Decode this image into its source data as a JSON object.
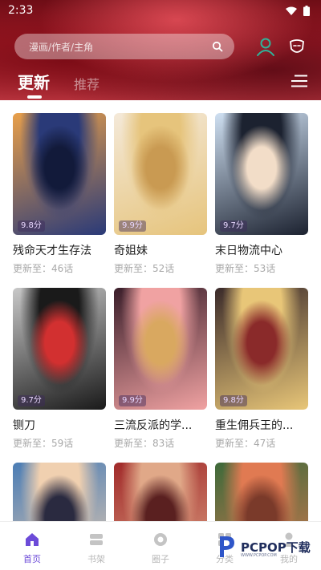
{
  "status": {
    "time": "2:33"
  },
  "search": {
    "placeholder": "漫画/作者/主角"
  },
  "tabs": {
    "active": "更新",
    "inactive": "推荐"
  },
  "comics": [
    {
      "title": "残命天才生存法",
      "update": "更新至：46话",
      "rating": "9.8分",
      "palette": [
        "#e9a04a",
        "#2a3a78",
        "#121a3a"
      ]
    },
    {
      "title": "奇姐妹",
      "update": "更新至：52话",
      "rating": "9.9分",
      "palette": [
        "#f4e9d9",
        "#e6c47c",
        "#c99a52"
      ]
    },
    {
      "title": "末日物流中心",
      "update": "更新至：53话",
      "rating": "9.7分",
      "palette": [
        "#cfe0f2",
        "#1c2230",
        "#f2ddc8"
      ]
    },
    {
      "title": "铡刀",
      "update": "更新至：59话",
      "rating": "9.7分",
      "palette": [
        "#c8c8c8",
        "#1a1a1a",
        "#d23030"
      ]
    },
    {
      "title": "三流反派的学...",
      "update": "更新至：83话",
      "rating": "9.9分",
      "palette": [
        "#3a1e2a",
        "#f0a2a2",
        "#d9a860"
      ]
    },
    {
      "title": "重生佣兵王的...",
      "update": "更新至：47话",
      "rating": "9.8分",
      "palette": [
        "#3a2a2a",
        "#e8c678",
        "#8a2a2a"
      ]
    },
    {
      "title": "",
      "update": "",
      "rating": "",
      "palette": [
        "#4b7db5",
        "#f0d0b0",
        "#2a2a40"
      ]
    },
    {
      "title": "",
      "update": "",
      "rating": "",
      "palette": [
        "#a12a2a",
        "#e0a888",
        "#5a2020"
      ]
    },
    {
      "title": "",
      "update": "",
      "rating": "",
      "palette": [
        "#3d6a3a",
        "#e07a52",
        "#7a3a2a"
      ]
    }
  ],
  "nav": [
    {
      "label": "首页",
      "icon": "home-icon",
      "active": true
    },
    {
      "label": "书架",
      "icon": "bookshelf-icon",
      "active": false
    },
    {
      "label": "圈子",
      "icon": "circle-icon",
      "active": false
    },
    {
      "label": "分类",
      "icon": "category-icon",
      "active": false
    },
    {
      "label": "我的",
      "icon": "user-icon",
      "active": false
    }
  ],
  "watermark": {
    "brand": "PCPOP下载",
    "sub": "WWW.PCPOP.COM"
  },
  "colors": {
    "accent": "#6c4bd8",
    "header": "#a31a26",
    "profile_icon": "#2fb39a"
  }
}
